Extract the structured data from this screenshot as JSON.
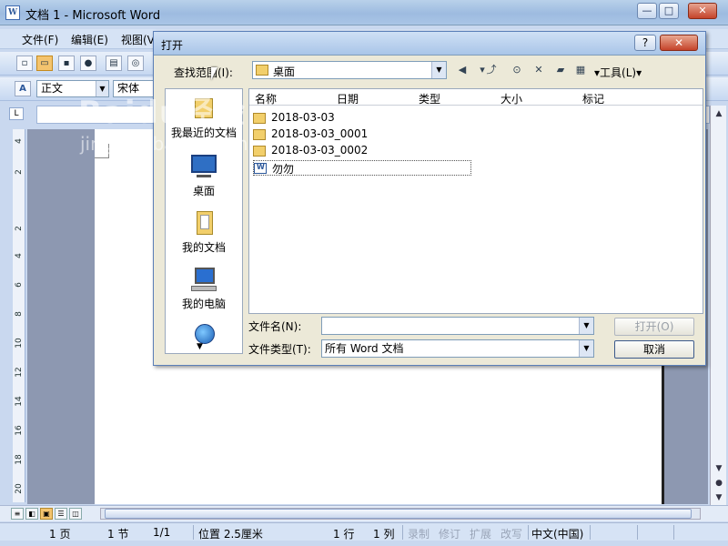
{
  "word": {
    "title": "文档 1 - Microsoft Word",
    "caption_buttons": {
      "minimize": "—",
      "maximize": "□",
      "close": "✕"
    },
    "menu": [
      "文件(F)",
      "编辑(E)",
      "视图(V)"
    ],
    "style_box": "正文",
    "font_box": "宋体",
    "vruler_ticks": [
      "4",
      "2",
      "2",
      "4",
      "6",
      "8",
      "10",
      "12",
      "14",
      "16",
      "18",
      "20"
    ],
    "status": {
      "page": "1 页",
      "section": "1 节",
      "page_of": "1/1",
      "position": "位置 2.5厘米",
      "line": "1 行",
      "column": "1 列",
      "rec": "录制",
      "trk": "修订",
      "ext": "扩展",
      "ovr": "改写",
      "language": "中文(中国)"
    }
  },
  "dialog": {
    "title": "打开",
    "help": "?",
    "close": "✕",
    "look_in_label": "查找范围(I):",
    "look_in_value": "桌面",
    "tools_label": "▾工具(L)▾",
    "places": [
      {
        "label": "我最近的文档",
        "icon": "recent-docs-icon"
      },
      {
        "label": "桌面",
        "icon": "desktop-icon"
      },
      {
        "label": "我的文档",
        "icon": "my-documents-icon"
      },
      {
        "label": "我的电脑",
        "icon": "my-computer-icon"
      },
      {
        "label": "",
        "icon": "network-icon"
      }
    ],
    "columns": [
      "名称",
      "日期",
      "类型",
      "大小",
      "标记"
    ],
    "files": [
      {
        "name": "2018-03-03",
        "kind": "folder"
      },
      {
        "name": "2018-03-03_0001",
        "kind": "folder"
      },
      {
        "name": "2018-03-03_0002",
        "kind": "folder"
      },
      {
        "name": "勿勿",
        "kind": "word-doc"
      }
    ],
    "file_name_label": "文件名(N):",
    "file_name_value": "",
    "file_type_label": "文件类型(T):",
    "file_type_value": "所有 Word 文档",
    "open_button": "打开(O)",
    "cancel_button": "取消"
  },
  "watermark": {
    "line1": "Baidu经验",
    "line2": "jingyan.baidu.com"
  }
}
